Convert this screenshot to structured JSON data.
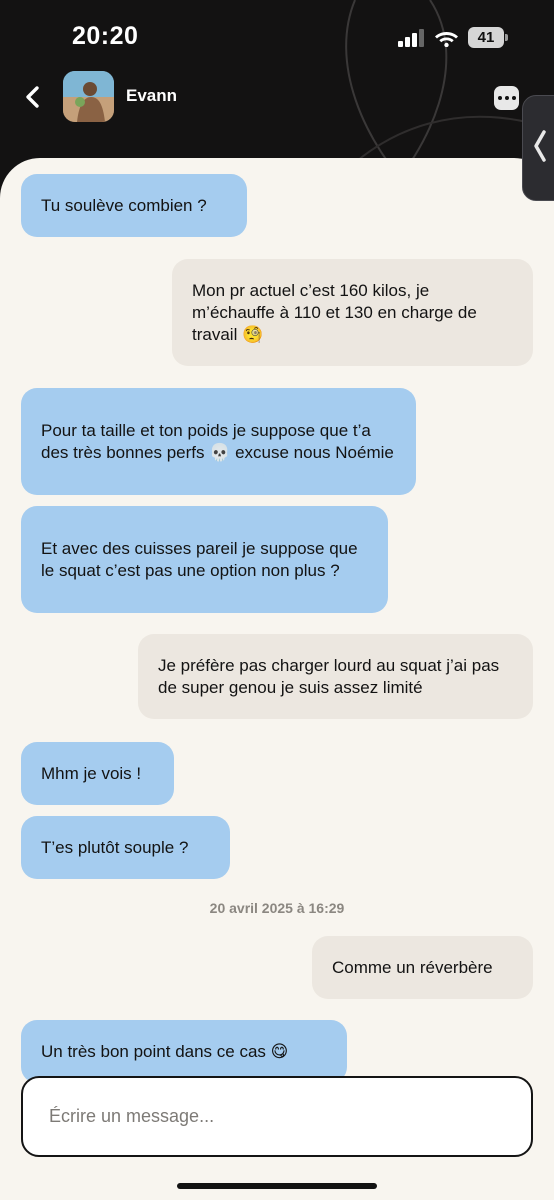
{
  "status": {
    "time": "20:20",
    "battery": "41"
  },
  "header": {
    "contact_name": "Evann"
  },
  "messages": [
    {
      "from": "them",
      "text": "Tu soulève combien ?"
    },
    {
      "from": "me",
      "text": "Mon pr actuel c’est 160 kilos, je m’échauffe à 110 et 130 en charge de travail 🧐"
    },
    {
      "from": "them",
      "text": "Pour ta taille et ton poids je suppose que t’a des très bonnes perfs 💀 excuse nous Noémie"
    },
    {
      "from": "them",
      "text": "Et avec des cuisses pareil je suppose que le squat c’est pas une option non plus ?"
    },
    {
      "from": "me",
      "text": "Je préfère pas charger lourd au squat j’ai pas de super genou je suis assez limité"
    },
    {
      "from": "them",
      "text": "Mhm je vois !"
    },
    {
      "from": "them",
      "text": "T’es plutôt souple ?"
    },
    {
      "from": "me",
      "text": "Comme un réverbère"
    },
    {
      "from": "them",
      "text": "Un très bon point dans ce cas 😋"
    }
  ],
  "timestamp": "20 avril 2025 à 16:29",
  "composer": {
    "placeholder": "Écrire un message..."
  },
  "colors": {
    "incoming": "#a5ccef",
    "outgoing": "#ece7e0",
    "background": "#f8f5ef",
    "header": "#131212"
  }
}
